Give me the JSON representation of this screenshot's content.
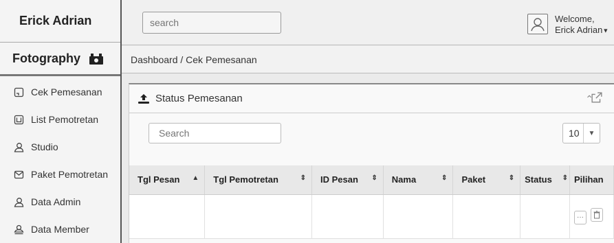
{
  "brand": {
    "line1": "Erick Adrian",
    "line2": "Fotography"
  },
  "sidebar": {
    "items": [
      {
        "label": "Cek Pemesanan",
        "icon": "order-icon"
      },
      {
        "label": "List Pemotretan",
        "icon": "list-icon"
      },
      {
        "label": "Studio",
        "icon": "user-icon"
      },
      {
        "label": "Paket Pemotretan",
        "icon": "mail-icon"
      },
      {
        "label": "Data Admin",
        "icon": "user-icon"
      },
      {
        "label": "Data Member",
        "icon": "users-icon"
      }
    ]
  },
  "header": {
    "search_placeholder": "search",
    "welcome_line1": "Welcome,",
    "welcome_line2": "Erick Adrian"
  },
  "breadcrumb": "Dashboard / Cek Pemesanan",
  "panel": {
    "title": "Status Pemesanan",
    "search_label": "Search",
    "page_size": "10"
  },
  "table": {
    "columns": [
      "Tgl Pesan",
      "Tgl Pemotretan",
      "ID Pesan",
      "Nama",
      "Paket",
      "Status",
      "Pilihan"
    ],
    "action_more": "···"
  },
  "colors": {
    "sidebar_bg": "#f4f4f4",
    "panel_bg": "#f9f9f9",
    "header_row_bg": "#e8e8e8"
  }
}
